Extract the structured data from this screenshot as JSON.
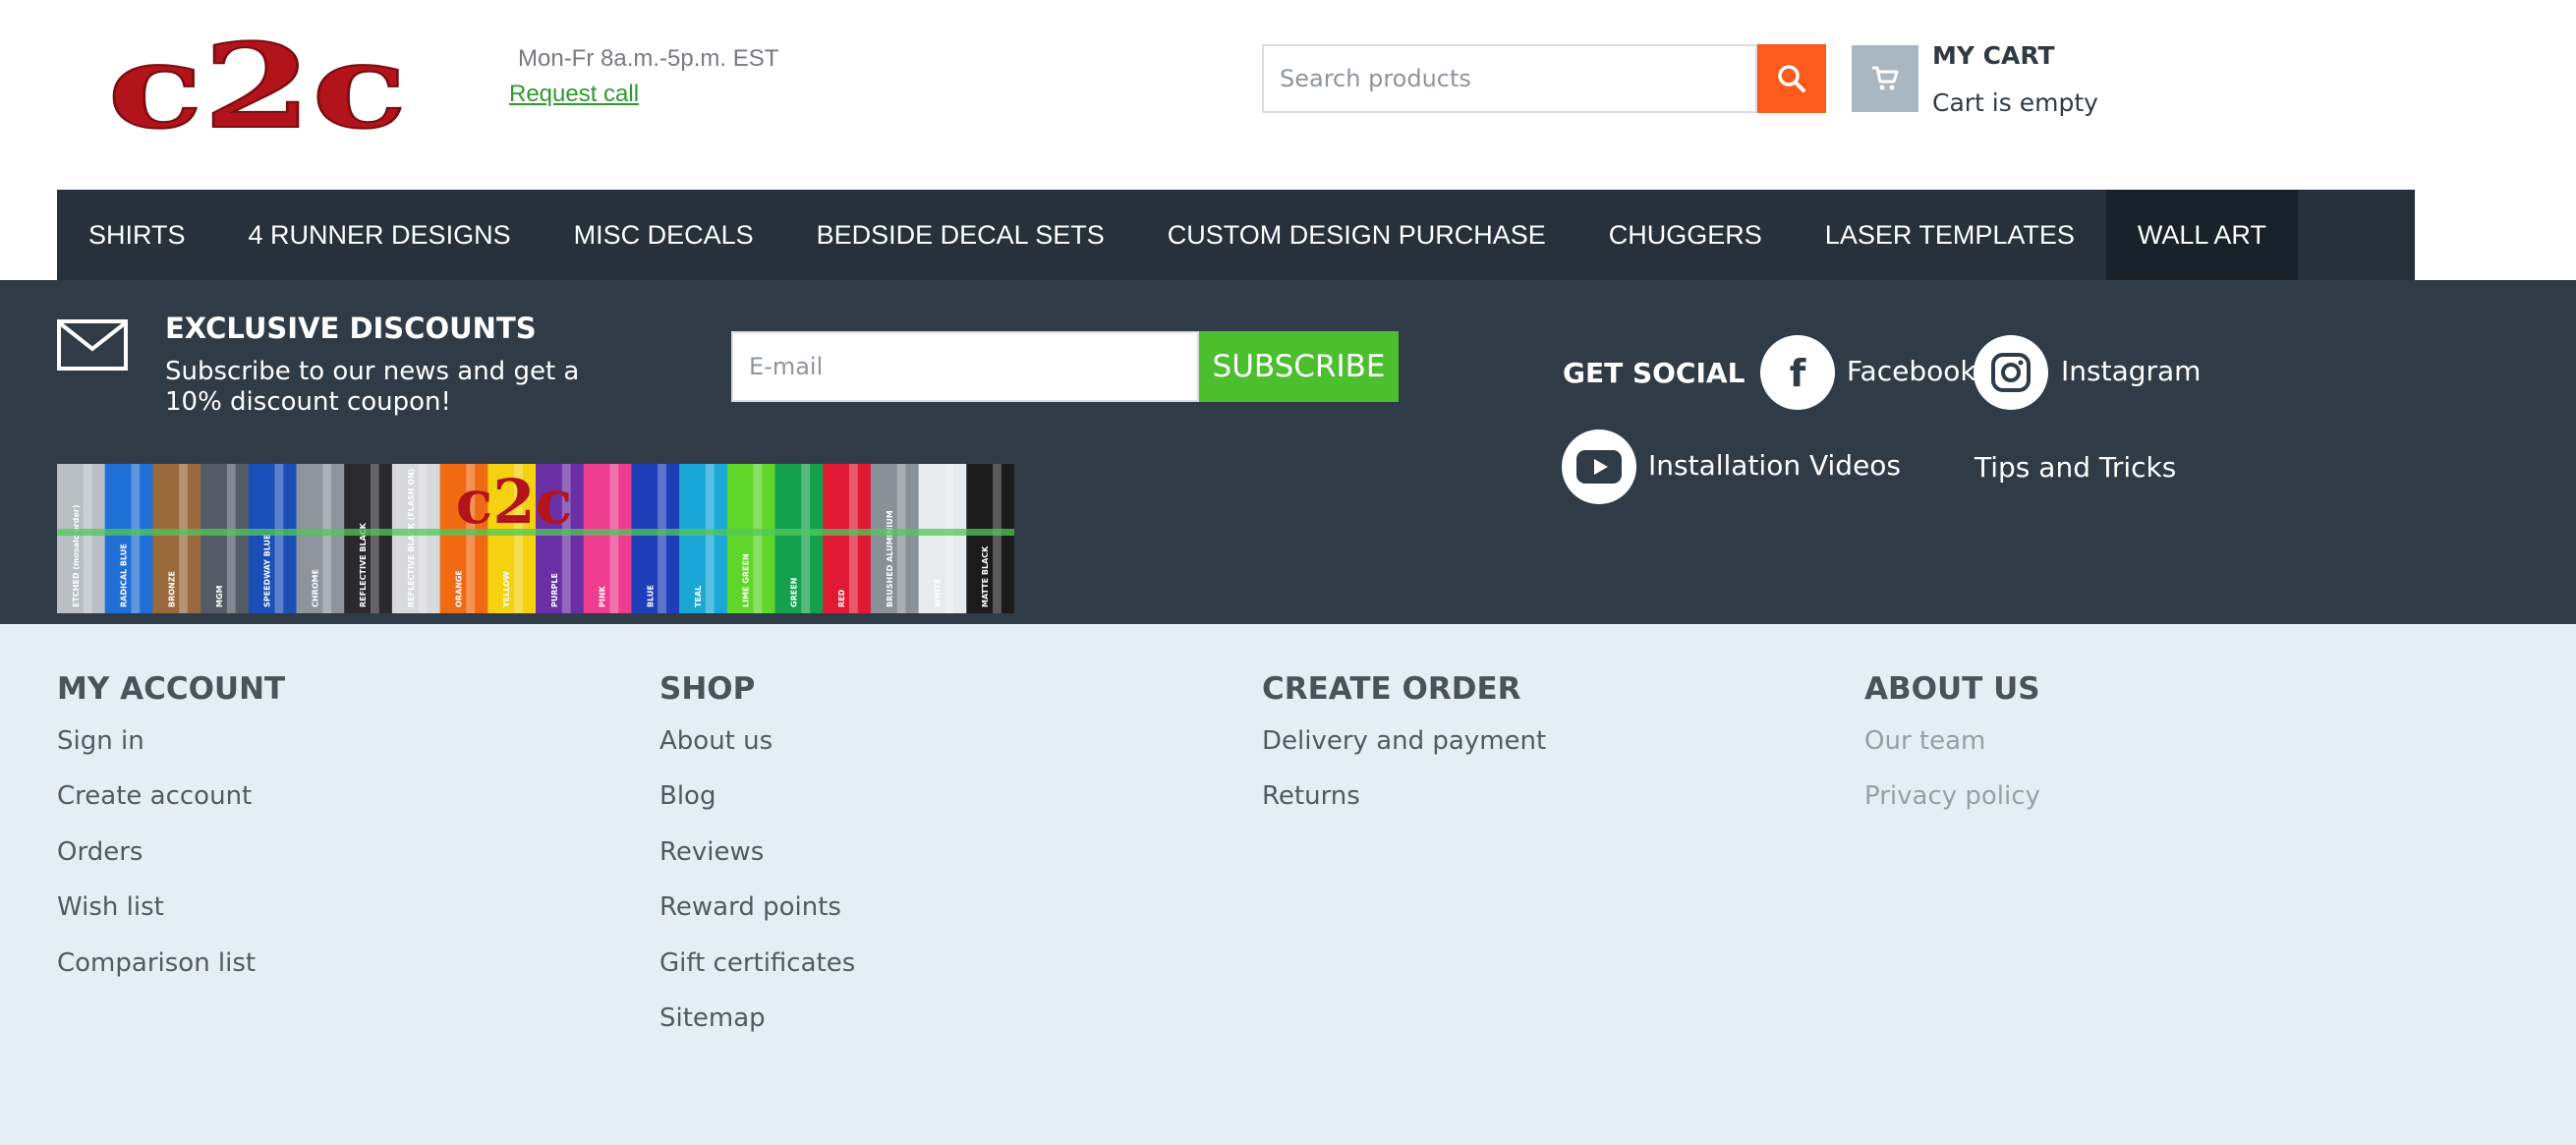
{
  "header": {
    "logo_text": "c2c",
    "hours": "Mon-Fr 8a.m.-5p.m. EST",
    "request_call": "Request call",
    "search": {
      "placeholder": "Search products"
    },
    "cart": {
      "title": "MY CART",
      "status": "Cart is empty"
    }
  },
  "nav": {
    "items": [
      {
        "label": "SHIRTS"
      },
      {
        "label": "4 RUNNER DESIGNS"
      },
      {
        "label": "MISC DECALS"
      },
      {
        "label": "BEDSIDE DECAL SETS"
      },
      {
        "label": "CUSTOM DESIGN PURCHASE"
      },
      {
        "label": "CHUGGERS"
      },
      {
        "label": "LASER TEMPLATES"
      },
      {
        "label": "WALL ART",
        "active": true
      }
    ]
  },
  "subscribe": {
    "title": "EXCLUSIVE DISCOUNTS",
    "text": "Subscribe to our news and get a 10% discount coupon!",
    "email_placeholder": "E-mail",
    "button_label": "SUBSCRIBE"
  },
  "social": {
    "heading": "GET SOCIAL",
    "facebook": "Facebook",
    "instagram": "Instagram",
    "youtube": "Installation Videos",
    "tips": "Tips and Tricks"
  },
  "banner": {
    "logo_text": "c2c",
    "swatches": [
      {
        "label": "ETCHED (mosaic order)",
        "color": "#b9bec4"
      },
      {
        "label": "RADICAL BLUE",
        "color": "#1f6fd6"
      },
      {
        "label": "BRONZE",
        "color": "#9a6a3c"
      },
      {
        "label": "MGM",
        "color": "#545b66"
      },
      {
        "label": "SPEEDWAY BLUE",
        "color": "#1b4fb8"
      },
      {
        "label": "CHROME",
        "color": "#8d949c"
      },
      {
        "label": "REFLECTIVE BLACK",
        "color": "#2a2a2e"
      },
      {
        "label": "REFLECTIVE BLACK (FLASH ON)",
        "color": "#d8d9dc"
      },
      {
        "label": "ORANGE",
        "color": "#f06a14"
      },
      {
        "label": "YELLOW",
        "color": "#f4d20f"
      },
      {
        "label": "PURPLE",
        "color": "#6b2fa5"
      },
      {
        "label": "PINK",
        "color": "#ee3c8e"
      },
      {
        "label": "BLUE",
        "color": "#1f3fb9"
      },
      {
        "label": "TEAL",
        "color": "#1aa7d8"
      },
      {
        "label": "LIME GREEN",
        "color": "#5fd62a"
      },
      {
        "label": "GREEN",
        "color": "#14a04c"
      },
      {
        "label": "RED",
        "color": "#e01934"
      },
      {
        "label": "BRUSHED ALUMINIUM",
        "color": "#8a9098"
      },
      {
        "label": "WHITE",
        "color": "#e8ebee"
      },
      {
        "label": "MATTE BLACK",
        "color": "#1b1b1c"
      }
    ]
  },
  "footer": {
    "my_account": {
      "title": "MY ACCOUNT",
      "links": [
        "Sign in",
        "Create account",
        "Orders",
        "Wish list",
        "Comparison list"
      ]
    },
    "shop": {
      "title": "SHOP",
      "links": [
        "About us",
        "Blog",
        "Reviews",
        "Reward points",
        "Gift certificates",
        "Sitemap"
      ]
    },
    "create_order": {
      "title": "CREATE ORDER",
      "links": [
        "Delivery and payment",
        "Returns"
      ]
    },
    "about_us": {
      "title": "ABOUT US",
      "links": [
        "Our team",
        "Privacy policy"
      ]
    }
  },
  "colors": {
    "brand_red": "#b3131a",
    "nav_bg": "#26313b",
    "subscribe_bg": "#2f3c48",
    "search_button": "#fd5a1e",
    "subscribe_button": "#4bbf2e",
    "footer_bg": "#e6eef5"
  }
}
